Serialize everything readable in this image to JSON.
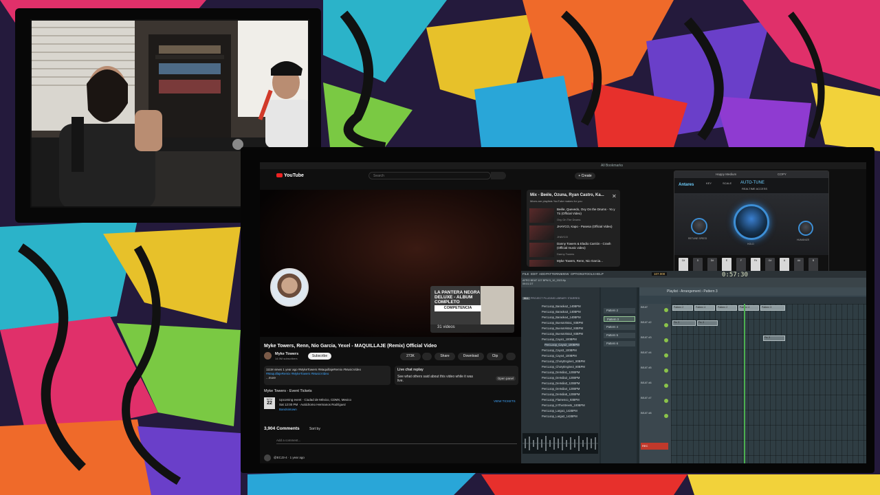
{
  "colors": {
    "youtube_red": "#ff0000",
    "link_blue": "#3ea6ff",
    "antares_blue": "#6fd0ff",
    "fl_green": "#4caf50"
  },
  "taskbar": {
    "bookmarks": "All Bookmarks"
  },
  "youtube": {
    "logo": "YouTube",
    "search_placeholder": "Search",
    "create_label": "+ Create",
    "playlist_card": {
      "title": "LA PANTERA NEGRA DELUXE - ALBUM COMPLETO",
      "band": "COMPETENCIA",
      "count": "31 videos"
    },
    "video_title": "Myke Towers, Renn, Nio Garcia, Yexel - MAQUILLAJE (Remix) Official Video",
    "channel": {
      "name": "Myke Towers",
      "subs": "14.9M subscribers",
      "subscribe": "Subscribe"
    },
    "actions": {
      "likes": "273K",
      "share": "Share",
      "download": "Download",
      "clip": "Clip"
    },
    "description": {
      "stats": "111M views  1 year ago  #MykeTowers #MaquillajeRemix #MusicVideo",
      "tags": "#MaquillajeRemix #MykeTowers #MusicVideo",
      "more": "...more"
    },
    "live_chat": {
      "title": "Live chat replay",
      "text": "See what others said about this video while it was live.",
      "open": "Open panel"
    },
    "events": {
      "header": "Myke Towers - Event Tickets",
      "month": "NOV",
      "day": "22",
      "line1": "Upcoming event · Ciudad de México, CDMX, Mexico",
      "line2": "Sat 12:00 PM · Autódromo Hermanos Rodríguez",
      "seller": "Bandsintown",
      "tickets": "VIEW TICKETS"
    },
    "comments": {
      "count": "3,904 Comments",
      "sort": "Sort by",
      "add": "Add a comment...",
      "first": "@ECJ3-4 · 1 year ago"
    }
  },
  "mix": {
    "title": "Mix - Beéle, Ozuna, Ryan Castro, Ka...",
    "subtitle": "Mixes are playlists YouTube makes for you",
    "items": [
      {
        "name": "Beéle, Quevedo, Ovy On the Drums - Yo y Tú (Official Video)",
        "channel": "Ovy On The Drums"
      },
      {
        "name": "JHAYCO, Kapo - Pasesa (Official Video)",
        "channel": "JHAYCO"
      },
      {
        "name": "Danny Towers & Eladio Carrión - Crash (Official music video)",
        "channel": "Danny Towers"
      },
      {
        "name": "Myke Towers, Renn, Nio Garcia...",
        "channel": ""
      }
    ]
  },
  "plugin": {
    "preset": "Happy Medium",
    "copy": "COPY",
    "brand": "Antares",
    "key_label": "KEY",
    "scale_label": "SCALE",
    "product": "AUTO-TUNE",
    "mode": "REALTIME ACCESS",
    "knobs": {
      "left": "RETUNE SPEED",
      "center": "HOLD",
      "right": "HUMANIZE"
    },
    "keys": [
      "C#",
      "D",
      "D#",
      "E",
      "F",
      "F#",
      "G#",
      "A",
      "A#",
      "B"
    ]
  },
  "fl": {
    "menu": [
      "FILE",
      "EDIT",
      "ADD",
      "PATTERNS",
      "VIEW",
      "OPTIONS",
      "TOOLS",
      "HELP"
    ],
    "time": "0:57:30",
    "tempo": "107.000",
    "info_line1": "AFRO BEAT 107 BPM 5_10_2023.flp",
    "info_line2": "09:01 DT",
    "browser_tabs": [
      "ALL",
      "PROJECT",
      "PLUGINS",
      "LIBRARY",
      "STARRED"
    ],
    "files": [
      "PercLoop_Baraoka2_140BPM",
      "PercLoop_Baraoka3_140BPM",
      "PercLoop_Baraoka4_140BPM",
      "PercLoop_BuenaVista1_93BPM",
      "PercLoop_BuenaVista2_93BPM",
      "PercLoop_BuenaVista3_93BPM",
      "PercLoop_Cayo1_100BPM",
      "PercLoop_Cayo2_100BPM",
      "PercLoop_Cayo3_100BPM",
      "PercLoop_Cayo4_100BPM",
      "PercLoop_ChoryEngine1_80BPM",
      "PercLoop_ChoryEngine2_80BPM",
      "PercLoop_DeIndia1_120BPM",
      "PercLoop_DeIndia2_120BPM",
      "PercLoop_DeIndia3_120BPM",
      "PercLoop_DeIndia4_120BPM",
      "PercLoop_DeIndia5_120BPM",
      "PercLoop_Flamenco_93BPM",
      "PercLoop_InTheStreets_100BPM",
      "PercLoop_Larga1_142BPM",
      "PercLoop_Larga2_142BPM"
    ],
    "patterns": [
      "Pattern 2",
      "Pattern 3",
      "Pattern 4",
      "Pattern 5",
      "Pattern 6"
    ],
    "playlist_title": "Playlist - Arrangement › Pattern 3",
    "tracks": [
      "BEAT",
      "BEAT #2",
      "BEAT #3",
      "BEAT #4",
      "BEAT #5",
      "BEAT #6",
      "BEAT #7",
      "BEAT #8"
    ],
    "clip_labels": [
      "Pattern 2",
      "Pattern 4",
      "Pattern 2",
      "Pattern 4",
      "Pattern 3",
      "Pa..3",
      "Pa..3",
      "Pa..3"
    ],
    "rec": "REC"
  }
}
